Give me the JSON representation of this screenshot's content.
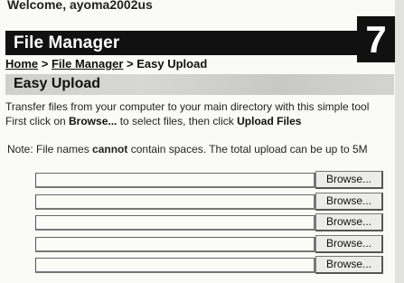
{
  "welcome": "Welcome, ayoma2002us",
  "header": {
    "title": "File Manager",
    "page_number": "7"
  },
  "breadcrumb": {
    "home": "Home",
    "separator1": " > ",
    "file_manager": "File Manager",
    "separator2": " > ",
    "current": "Easy Upload"
  },
  "section": {
    "title": "Easy Upload"
  },
  "description": {
    "line1": "Transfer files from your computer to your main directory with this simple tool",
    "line2_pre": "First click on ",
    "line2_browse": "Browse...",
    "line2_mid": " to select files, then click ",
    "line2_upload": "Upload Files"
  },
  "note": {
    "pre": "Note: File names ",
    "bold": "cannot",
    "post": " contain spaces. The total upload can be up to 5M"
  },
  "uploads": {
    "browse_label": "Browse...",
    "rows": [
      {
        "value": "",
        "browse": "Browse..."
      },
      {
        "value": "",
        "browse": "Browse..."
      },
      {
        "value": "",
        "browse": "Browse..."
      },
      {
        "value": "",
        "browse": "Browse..."
      },
      {
        "value": "",
        "browse": "Browse..."
      }
    ]
  }
}
